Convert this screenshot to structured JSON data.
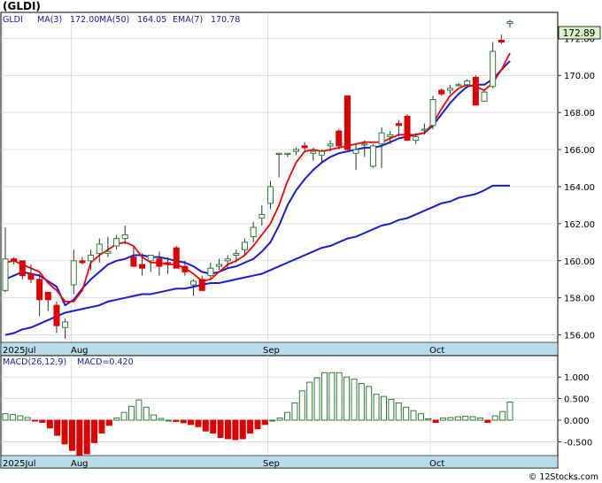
{
  "title": "(GLDI)",
  "legend": {
    "symbol": "GLDI",
    "ma3": "MA(3)",
    "ma3_value": "172.00",
    "ma50": "MA(50)",
    "ma50_value": "164.05",
    "ema7": "EMA(7)",
    "ema7_value": "170.78"
  },
  "current_price": "172.89",
  "macd_legend": {
    "params": "MACD(26,12,9)",
    "value": "MACD=0.420"
  },
  "footer": "© 12Stocks.com",
  "colors": {
    "up_candle": "#2e7d32",
    "down_candle": "#e00000",
    "ma3": "#ff0000",
    "ma_blue": "#1a1adc",
    "macd_bar": "#2e7d32",
    "macd_neg": "#e00000",
    "axis_strip": "#b8dde8",
    "legend_text": "#1a1aa0",
    "price_box": "#d9f2c8"
  },
  "chart_data": [
    {
      "type": "candlestick",
      "title": "(GLDI)",
      "ylim": [
        155.6,
        173.4
      ],
      "y_ticks": [
        "156.00",
        "158.00",
        "160.00",
        "162.00",
        "164.00",
        "166.00",
        "168.00",
        "170.00",
        "172.00"
      ],
      "x_ticks": [
        "2025Jul",
        "Aug",
        "Sep",
        "Oct"
      ],
      "grid": true,
      "ohlc": [
        [
          158.4,
          161.8,
          158.3,
          160.1
        ],
        [
          160.1,
          160.2,
          159.8,
          160.0
        ],
        [
          160.0,
          160.0,
          159.0,
          159.2
        ],
        [
          159.3,
          159.8,
          158.8,
          159.0
        ],
        [
          159.0,
          159.3,
          157.0,
          157.9
        ],
        [
          158.3,
          158.3,
          157.3,
          157.9
        ],
        [
          157.6,
          157.8,
          156.1,
          156.5
        ],
        [
          156.4,
          156.9,
          155.8,
          156.7
        ],
        [
          158.7,
          160.6,
          158.2,
          160.0
        ],
        [
          160.0,
          160.2,
          159.8,
          159.9
        ],
        [
          160.0,
          160.6,
          159.5,
          160.3
        ],
        [
          160.4,
          161.2,
          159.9,
          160.9
        ],
        [
          160.4,
          161.3,
          160.2,
          160.5
        ],
        [
          160.8,
          161.4,
          160.6,
          161.2
        ],
        [
          161.2,
          161.9,
          160.9,
          161.4
        ],
        [
          160.2,
          160.8,
          159.7,
          159.7
        ],
        [
          159.8,
          160.4,
          159.2,
          159.6
        ],
        [
          160.0,
          160.3,
          159.4,
          160.3
        ],
        [
          160.1,
          160.5,
          159.2,
          159.7
        ],
        [
          159.9,
          160.2,
          159.3,
          159.8
        ],
        [
          160.7,
          160.8,
          159.6,
          159.6
        ],
        [
          159.7,
          160.0,
          159.2,
          159.4
        ],
        [
          158.7,
          159.0,
          158.1,
          158.9
        ],
        [
          159.0,
          159.2,
          158.4,
          158.4
        ],
        [
          159.2,
          159.9,
          159.0,
          159.6
        ],
        [
          159.7,
          160.1,
          159.5,
          159.8
        ],
        [
          160.0,
          160.3,
          159.6,
          160.1
        ],
        [
          160.3,
          160.6,
          159.9,
          160.4
        ],
        [
          160.6,
          161.2,
          160.3,
          161.0
        ],
        [
          161.3,
          162.1,
          161.0,
          161.8
        ],
        [
          162.3,
          163.0,
          161.9,
          162.5
        ],
        [
          163.1,
          164.3,
          162.8,
          164.0
        ],
        [
          165.8,
          165.8,
          164.5,
          165.8
        ],
        [
          165.8,
          165.8,
          165.6,
          165.8
        ],
        [
          165.9,
          166.1,
          165.7,
          166.0
        ],
        [
          166.2,
          166.4,
          165.9,
          166.1
        ],
        [
          165.8,
          166.1,
          165.4,
          165.9
        ],
        [
          165.7,
          166.0,
          165.3,
          165.9
        ],
        [
          166.2,
          166.5,
          165.9,
          166.3
        ],
        [
          167.0,
          167.1,
          166.0,
          166.2
        ],
        [
          168.9,
          168.9,
          166.0,
          166.0
        ],
        [
          165.8,
          166.3,
          164.9,
          166.0
        ],
        [
          166.3,
          166.5,
          165.6,
          166.3
        ],
        [
          165.1,
          166.3,
          165.0,
          166.2
        ],
        [
          166.3,
          167.2,
          165.0,
          166.9
        ],
        [
          166.7,
          167.0,
          166.3,
          166.8
        ],
        [
          167.4,
          167.6,
          166.7,
          167.3
        ],
        [
          167.8,
          167.9,
          166.5,
          166.5
        ],
        [
          166.5,
          166.9,
          166.3,
          166.7
        ],
        [
          167.1,
          167.4,
          166.8,
          167.1
        ],
        [
          167.3,
          168.9,
          167.1,
          168.7
        ],
        [
          169.2,
          169.3,
          168.9,
          169.0
        ],
        [
          169.2,
          169.5,
          169.0,
          169.3
        ],
        [
          169.5,
          169.6,
          169.4,
          169.5
        ],
        [
          169.5,
          169.8,
          169.3,
          169.7
        ],
        [
          169.9,
          170.0,
          168.5,
          168.4
        ],
        [
          168.6,
          169.2,
          168.6,
          169.1
        ],
        [
          169.4,
          171.8,
          169.3,
          171.3
        ],
        [
          171.9,
          172.2,
          171.7,
          171.8
        ],
        [
          172.8,
          173.0,
          172.6,
          172.9
        ]
      ],
      "ma3": [
        159.9,
        160.0,
        159.8,
        159.6,
        159.4,
        158.8,
        158.4,
        157.8,
        157.8,
        158.4,
        159.9,
        160.3,
        160.6,
        160.9,
        161.0,
        160.8,
        160.2,
        159.9,
        159.9,
        159.8,
        159.8,
        159.6,
        159.3,
        158.9,
        159.0,
        159.4,
        159.8,
        160.0,
        160.3,
        160.8,
        161.4,
        162.0,
        163.0,
        164.3,
        165.3,
        165.9,
        166.0,
        165.9,
        166.0,
        166.1,
        166.2,
        166.3,
        166.4,
        166.4,
        166.4,
        166.6,
        166.8,
        166.8,
        166.8,
        166.9,
        167.4,
        168.2,
        168.9,
        169.3,
        169.5,
        169.4,
        169.2,
        169.6,
        170.3,
        171.2
      ],
      "ema7": [
        159.0,
        159.2,
        159.4,
        159.3,
        159.2,
        158.9,
        158.6,
        157.6,
        157.9,
        158.5,
        159.0,
        159.4,
        159.8,
        160.0,
        160.1,
        160.3,
        160.3,
        160.2,
        160.2,
        160.1,
        160.0,
        159.9,
        159.7,
        159.4,
        159.3,
        159.4,
        159.6,
        159.7,
        159.9,
        160.1,
        160.5,
        161.0,
        161.9,
        163.0,
        163.8,
        164.4,
        164.9,
        165.3,
        165.6,
        165.8,
        165.9,
        166.0,
        166.1,
        166.1,
        166.2,
        166.4,
        166.6,
        166.7,
        166.8,
        166.9,
        167.3,
        167.9,
        168.5,
        169.0,
        169.4,
        169.5,
        169.5,
        169.8,
        170.3,
        170.78
      ],
      "ma50": [
        156.0,
        156.1,
        156.3,
        156.4,
        156.6,
        156.8,
        157.0,
        157.2,
        157.3,
        157.4,
        157.5,
        157.6,
        157.8,
        157.9,
        158.0,
        158.1,
        158.2,
        158.2,
        158.3,
        158.4,
        158.5,
        158.5,
        158.6,
        158.7,
        158.8,
        158.8,
        158.9,
        159.0,
        159.1,
        159.2,
        159.3,
        159.5,
        159.7,
        159.9,
        160.1,
        160.3,
        160.5,
        160.7,
        160.8,
        161.0,
        161.2,
        161.3,
        161.5,
        161.7,
        161.9,
        162.0,
        162.2,
        162.3,
        162.5,
        162.7,
        162.9,
        163.1,
        163.2,
        163.4,
        163.5,
        163.6,
        163.8,
        164.05,
        164.05,
        164.05
      ]
    },
    {
      "type": "bar",
      "title": "MACD(26,12,9)",
      "ylim": [
        -0.82,
        1.25
      ],
      "y_ticks": [
        "1.000",
        "0.500",
        "0.000",
        "-0.500"
      ],
      "x_ticks": [
        "2025Jul",
        "Aug",
        "Sep",
        "Oct"
      ],
      "grid": true,
      "values": [
        0.15,
        0.13,
        0.1,
        0.06,
        -0.01,
        -0.05,
        -0.18,
        -0.35,
        -0.55,
        -0.7,
        -0.82,
        -0.78,
        -0.52,
        -0.3,
        -0.12,
        0.05,
        0.18,
        0.32,
        0.47,
        0.3,
        0.12,
        0.04,
        0.0,
        -0.03,
        -0.06,
        -0.1,
        -0.15,
        -0.25,
        -0.3,
        -0.4,
        -0.43,
        -0.45,
        -0.43,
        -0.3,
        -0.2,
        -0.1,
        0.0,
        0.05,
        0.18,
        0.4,
        0.68,
        0.88,
        0.98,
        1.1,
        1.1,
        1.1,
        1.0,
        0.95,
        0.85,
        0.78,
        0.6,
        0.55,
        0.48,
        0.4,
        0.3,
        0.22,
        0.15,
        0.03,
        -0.05,
        0.05
      ],
      "extra_tail": [
        0.06,
        0.08,
        0.09,
        0.08,
        0.05,
        -0.05,
        0.1,
        0.2,
        0.42
      ]
    }
  ]
}
